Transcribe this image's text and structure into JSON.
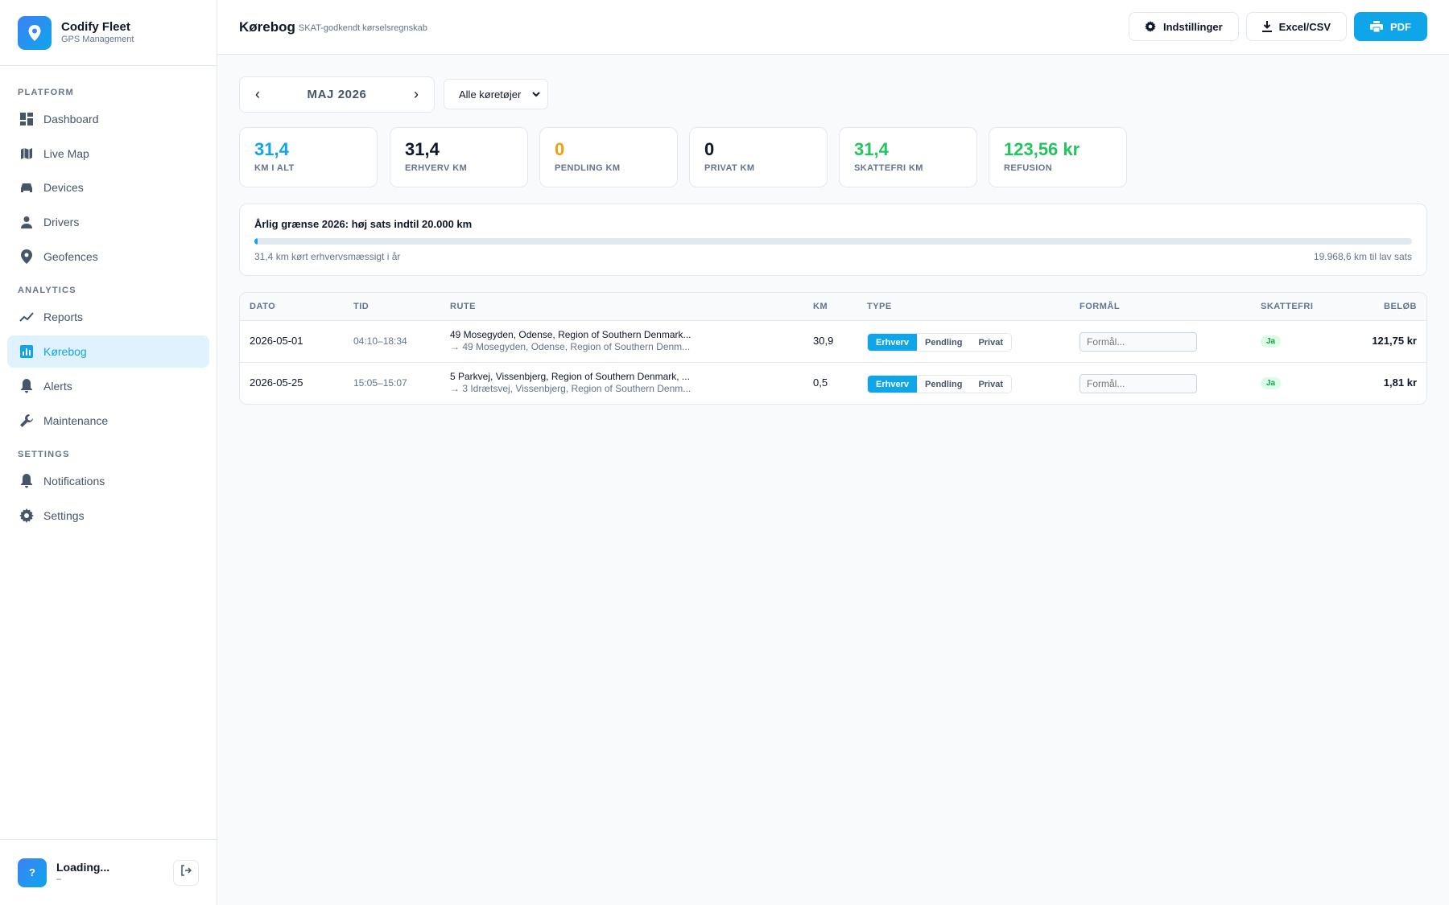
{
  "brand": {
    "name": "Codify Fleet",
    "subtitle": "GPS Management"
  },
  "sidebar": {
    "sections": [
      {
        "label": "PLATFORM"
      },
      {
        "label": "ANALYTICS"
      },
      {
        "label": "SETTINGS"
      }
    ],
    "items": [
      {
        "label": "Dashboard",
        "icon": "dashboard-icon"
      },
      {
        "label": "Live Map",
        "icon": "map-icon"
      },
      {
        "label": "Devices",
        "icon": "car-icon"
      },
      {
        "label": "Drivers",
        "icon": "person-icon"
      },
      {
        "label": "Geofences",
        "icon": "location-pin-icon"
      },
      {
        "label": "Reports",
        "icon": "trend-chart-icon"
      },
      {
        "label": "Kørebog",
        "icon": "bar-chart-icon",
        "active": true
      },
      {
        "label": "Alerts",
        "icon": "bell-icon"
      },
      {
        "label": "Maintenance",
        "icon": "wrench-icon"
      },
      {
        "label": "Notifications",
        "icon": "bell-icon"
      },
      {
        "label": "Settings",
        "icon": "gear-icon"
      }
    ]
  },
  "user": {
    "avatar": "?",
    "name": "Loading...",
    "role": "–"
  },
  "header": {
    "title": "Kørebog",
    "subtitle": "SKAT-godkendt kørselsregnskab",
    "buttons": {
      "settings": "Indstillinger",
      "export": "Excel/CSV",
      "pdf": "PDF"
    }
  },
  "toolbar": {
    "month": "MAJ 2026",
    "prev": "‹",
    "next": "›",
    "vehicle_filter": "Alle køretøjer"
  },
  "stats": [
    {
      "value": "31,4",
      "label": "KM I ALT",
      "color": "#0ea5e9"
    },
    {
      "value": "31,4",
      "label": "ERHVERV KM",
      "color": "#0f172a"
    },
    {
      "value": "0",
      "label": "PENDLING KM",
      "color": "#f59e0b"
    },
    {
      "value": "0",
      "label": "PRIVAT KM",
      "color": "#0f172a"
    },
    {
      "value": "31,4",
      "label": "SKATTEFRI KM",
      "color": "#22c55e"
    },
    {
      "value": "123,56 kr",
      "label": "REFUSION",
      "color": "#22c55e"
    }
  ],
  "limit": {
    "title": "Årlig grænse 2026: høj sats indtil 20.000 km",
    "driven_text": "31,4 km kørt erhvervsmæssigt i år",
    "remaining_text": "19.968,6 km til lav sats",
    "progress_fraction": 0.00157
  },
  "table": {
    "headers": {
      "date": "DATO",
      "time": "TID",
      "route": "RUTE",
      "km": "KM",
      "type": "TYPE",
      "purpose": "FORMÅL",
      "taxfree": "SKATTEFRI",
      "amount": "BELØB"
    },
    "type_options": [
      "Erhverv",
      "Pendling",
      "Privat"
    ],
    "purpose_placeholder": "Formål...",
    "rows": [
      {
        "date": "2026-05-01",
        "time": "04:10–18:34",
        "route_from": "49 Mosegyden, Odense, Region of Southern Denmark...",
        "route_to": "→ 49 Mosegyden, Odense, Region of Southern Denm...",
        "km": "30,9",
        "type": "Erhverv",
        "taxfree": "Ja",
        "amount": "121,75 kr"
      },
      {
        "date": "2026-05-25",
        "time": "15:05–15:07",
        "route_from": "5 Parkvej, Vissenbjerg, Region of Southern Denmark, ...",
        "route_to": "→ 3 Idrætsvej, Vissenbjerg, Region of Southern Denm...",
        "km": "0,5",
        "type": "Erhverv",
        "taxfree": "Ja",
        "amount": "1,81 kr"
      }
    ]
  }
}
